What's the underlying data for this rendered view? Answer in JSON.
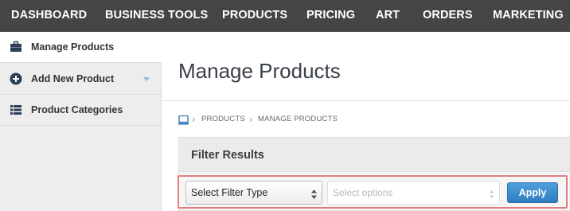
{
  "topnav": {
    "items": [
      {
        "label": "DASHBOARD"
      },
      {
        "label": "BUSINESS TOOLS"
      },
      {
        "label": "PRODUCTS"
      },
      {
        "label": "PRICING"
      },
      {
        "label": "ART"
      },
      {
        "label": "ORDERS"
      },
      {
        "label": "MARKETING"
      }
    ]
  },
  "sidebar": {
    "items": [
      {
        "label": "Manage Products",
        "icon": "briefcase-icon",
        "active": true
      },
      {
        "label": "Add New Product",
        "icon": "plus-circle-icon",
        "has_dropdown": true
      },
      {
        "label": "Product Categories",
        "icon": "list-icon"
      }
    ]
  },
  "main": {
    "title": "Manage Products",
    "breadcrumb": {
      "icon": "computer-icon",
      "items": [
        "PRODUCTS",
        "MANAGE PRODUCTS"
      ]
    },
    "filter": {
      "title": "Filter Results",
      "type_select": "Select Filter Type",
      "options_select_placeholder": "Select options",
      "apply_label": "Apply"
    }
  },
  "colors": {
    "nav_bg": "#444546",
    "sidebar_bg": "#ededed",
    "accent_blue": "#2f7dbf",
    "highlight_border": "#e07f82"
  }
}
